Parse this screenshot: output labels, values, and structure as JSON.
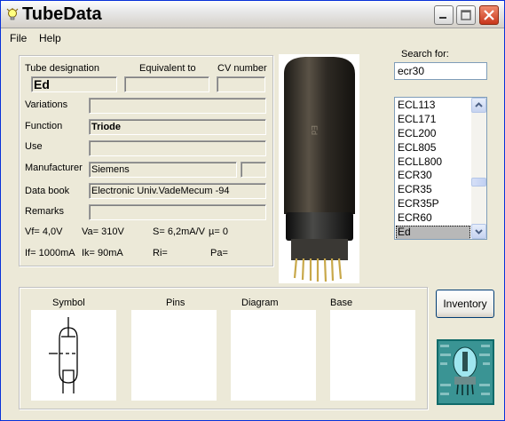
{
  "window": {
    "title": "TubeData"
  },
  "menu": {
    "file": "File",
    "help": "Help"
  },
  "info": {
    "tube_designation_label": "Tube designation",
    "equivalent_label": "Equivalent to",
    "cv_label": "CV number",
    "tube_designation_value": "Ed",
    "equivalent_value": "",
    "cv_value": "",
    "variations_label": "Variations",
    "variations_value": "",
    "function_label": "Function",
    "function_value": "Triode",
    "use_label": "Use",
    "use_value": "",
    "manufacturer_label": "Manufacturer",
    "manufacturer_value": "Siemens",
    "manufacturer_extra": "",
    "databook_label": "Data book",
    "databook_value": "Electronic Univ.VadeMecum -94",
    "remarks_label": "Remarks",
    "remarks_value": "",
    "vf": "Vf= 4,0V",
    "va": "Va=  310V",
    "s": "S= 6,2mA/V",
    "mu": "µ=    0",
    "if": "If= 1000mA",
    "ik": "Ik=   90mA",
    "ri": "Ri=",
    "pa": "Pa="
  },
  "search": {
    "label": "Search for:",
    "value": "ecr30",
    "list": [
      "ECL113",
      "ECL171",
      "ECL200",
      "ECL805",
      "ECLL800",
      "ECR30",
      "ECR35",
      "ECR35P",
      "ECR60",
      "Ed"
    ],
    "selected": "Ed"
  },
  "inventory_label": "Inventory",
  "pictures": {
    "symbol_label": "Symbol",
    "pins_label": "Pins",
    "diagram_label": "Diagram",
    "base_label": "Base"
  },
  "photo": {
    "tube_marking": "Ed"
  },
  "colors": {
    "window_bg": "#ece9d8",
    "selection": "#b8b8b8",
    "border_blue": "#7f9db9"
  }
}
